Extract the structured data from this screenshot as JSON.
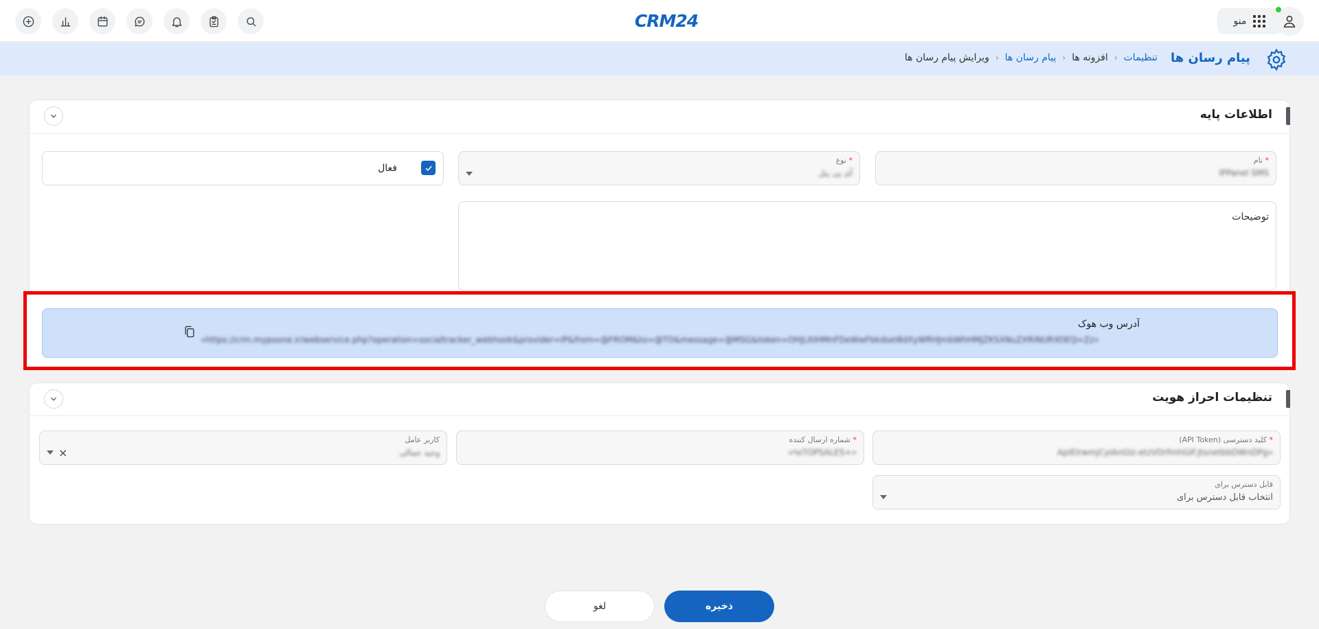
{
  "topbar": {
    "logo_text": "CRM24",
    "menu_label": "منو",
    "icons": [
      "add-circle-icon",
      "bar-chart-icon",
      "calendar-icon",
      "chat-icon",
      "bell-icon",
      "clipboard-icon",
      "search-icon",
      "user-icon"
    ]
  },
  "breadcrumb": {
    "title": "پیام رسان ها",
    "items": [
      {
        "label": "تنظیمات",
        "link": true
      },
      {
        "label": "افزونه ها",
        "link": false
      },
      {
        "label": "پیام رسان ها",
        "link": true
      },
      {
        "label": "ویرایش پیام رسان ها",
        "link": false
      }
    ],
    "separator": "‹"
  },
  "basic_info": {
    "title": "اطلاعات پایه",
    "name_label": "نام",
    "name_value": "IPPanel SMS",
    "type_label": "نوع",
    "type_value": "آی پی پنل",
    "active_label": "فعال",
    "active_checked": true,
    "description_label": "توضیحات",
    "required_mark": "*"
  },
  "webhook": {
    "label": "آدرس وب هوک",
    "url": "«https://crm.mypoone.ir/webservice.php?operation=socialtracker_webhook&provider=IP&from=@FROM&to=@TO&message=@MSG&token=OHJLItIHMnFDeWwFbkdseI8dXyWRHJmbWhHMJZKSXNuZXRiNURXOEQ=Zz»"
  },
  "auth": {
    "title": "تنظیمات احراز هویت",
    "api_token_label": "کلید دسترسی (API Token)",
    "api_token_value": "«ApIEIrwmjCyIAnGIz-etzVDrfmhGIF.JtsnetbbDWnDPg",
    "sender_label": "شماره ارسال کننده",
    "sender_value": "«+۹۸TOPSALES»",
    "operator_label": "کاربر عامل",
    "operator_value": "وحید جمالی",
    "access_label": "قابل دسترس برای",
    "access_placeholder": "انتخاب قابل دسترس برای",
    "required_mark": "*"
  },
  "actions": {
    "save_label": "ذخیره",
    "cancel_label": "لغو"
  },
  "colors": {
    "accent": "#1565c0",
    "breadcrumb_bg": "#deeafc",
    "webhook_bg": "#cfe0fb",
    "highlight_border": "#ee0000"
  }
}
